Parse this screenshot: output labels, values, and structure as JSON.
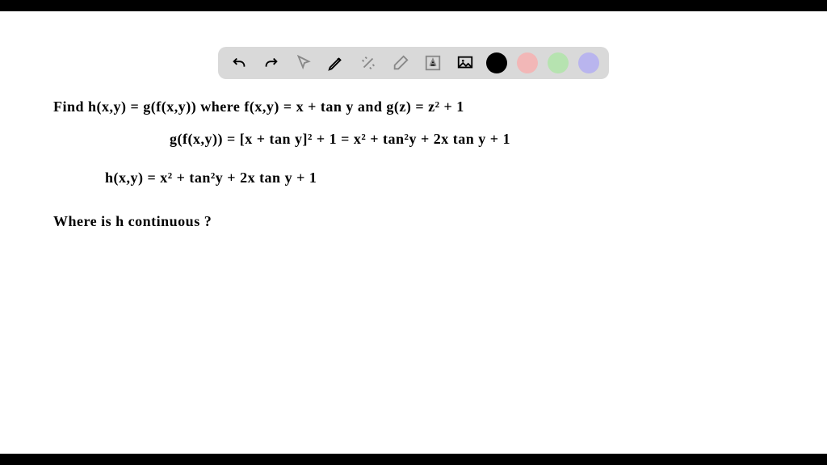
{
  "toolbar": {
    "icons": {
      "undo": "undo-icon",
      "redo": "redo-icon",
      "pointer": "pointer-icon",
      "pen": "pen-icon",
      "tools": "tools-icon",
      "eraser": "eraser-icon",
      "text": "text-icon",
      "image": "image-icon"
    },
    "colors": {
      "black": "#000000",
      "pink": "#f2b7b7",
      "green": "#b6e3b0",
      "purple": "#b9b5ee"
    }
  },
  "handwriting": {
    "line1": "Find   h(x,y) = g(f(x,y))   where   f(x,y) = x + tan y    and  g(z) = z² + 1",
    "line2": "g(f(x,y)) = [x + tan y]²  + 1  =  x² + tan²y  +  2x tan y  + 1",
    "line3": "h(x,y) =  x² + tan²y + 2x tan y + 1",
    "line4": "Where  is  h  continuous ?"
  }
}
